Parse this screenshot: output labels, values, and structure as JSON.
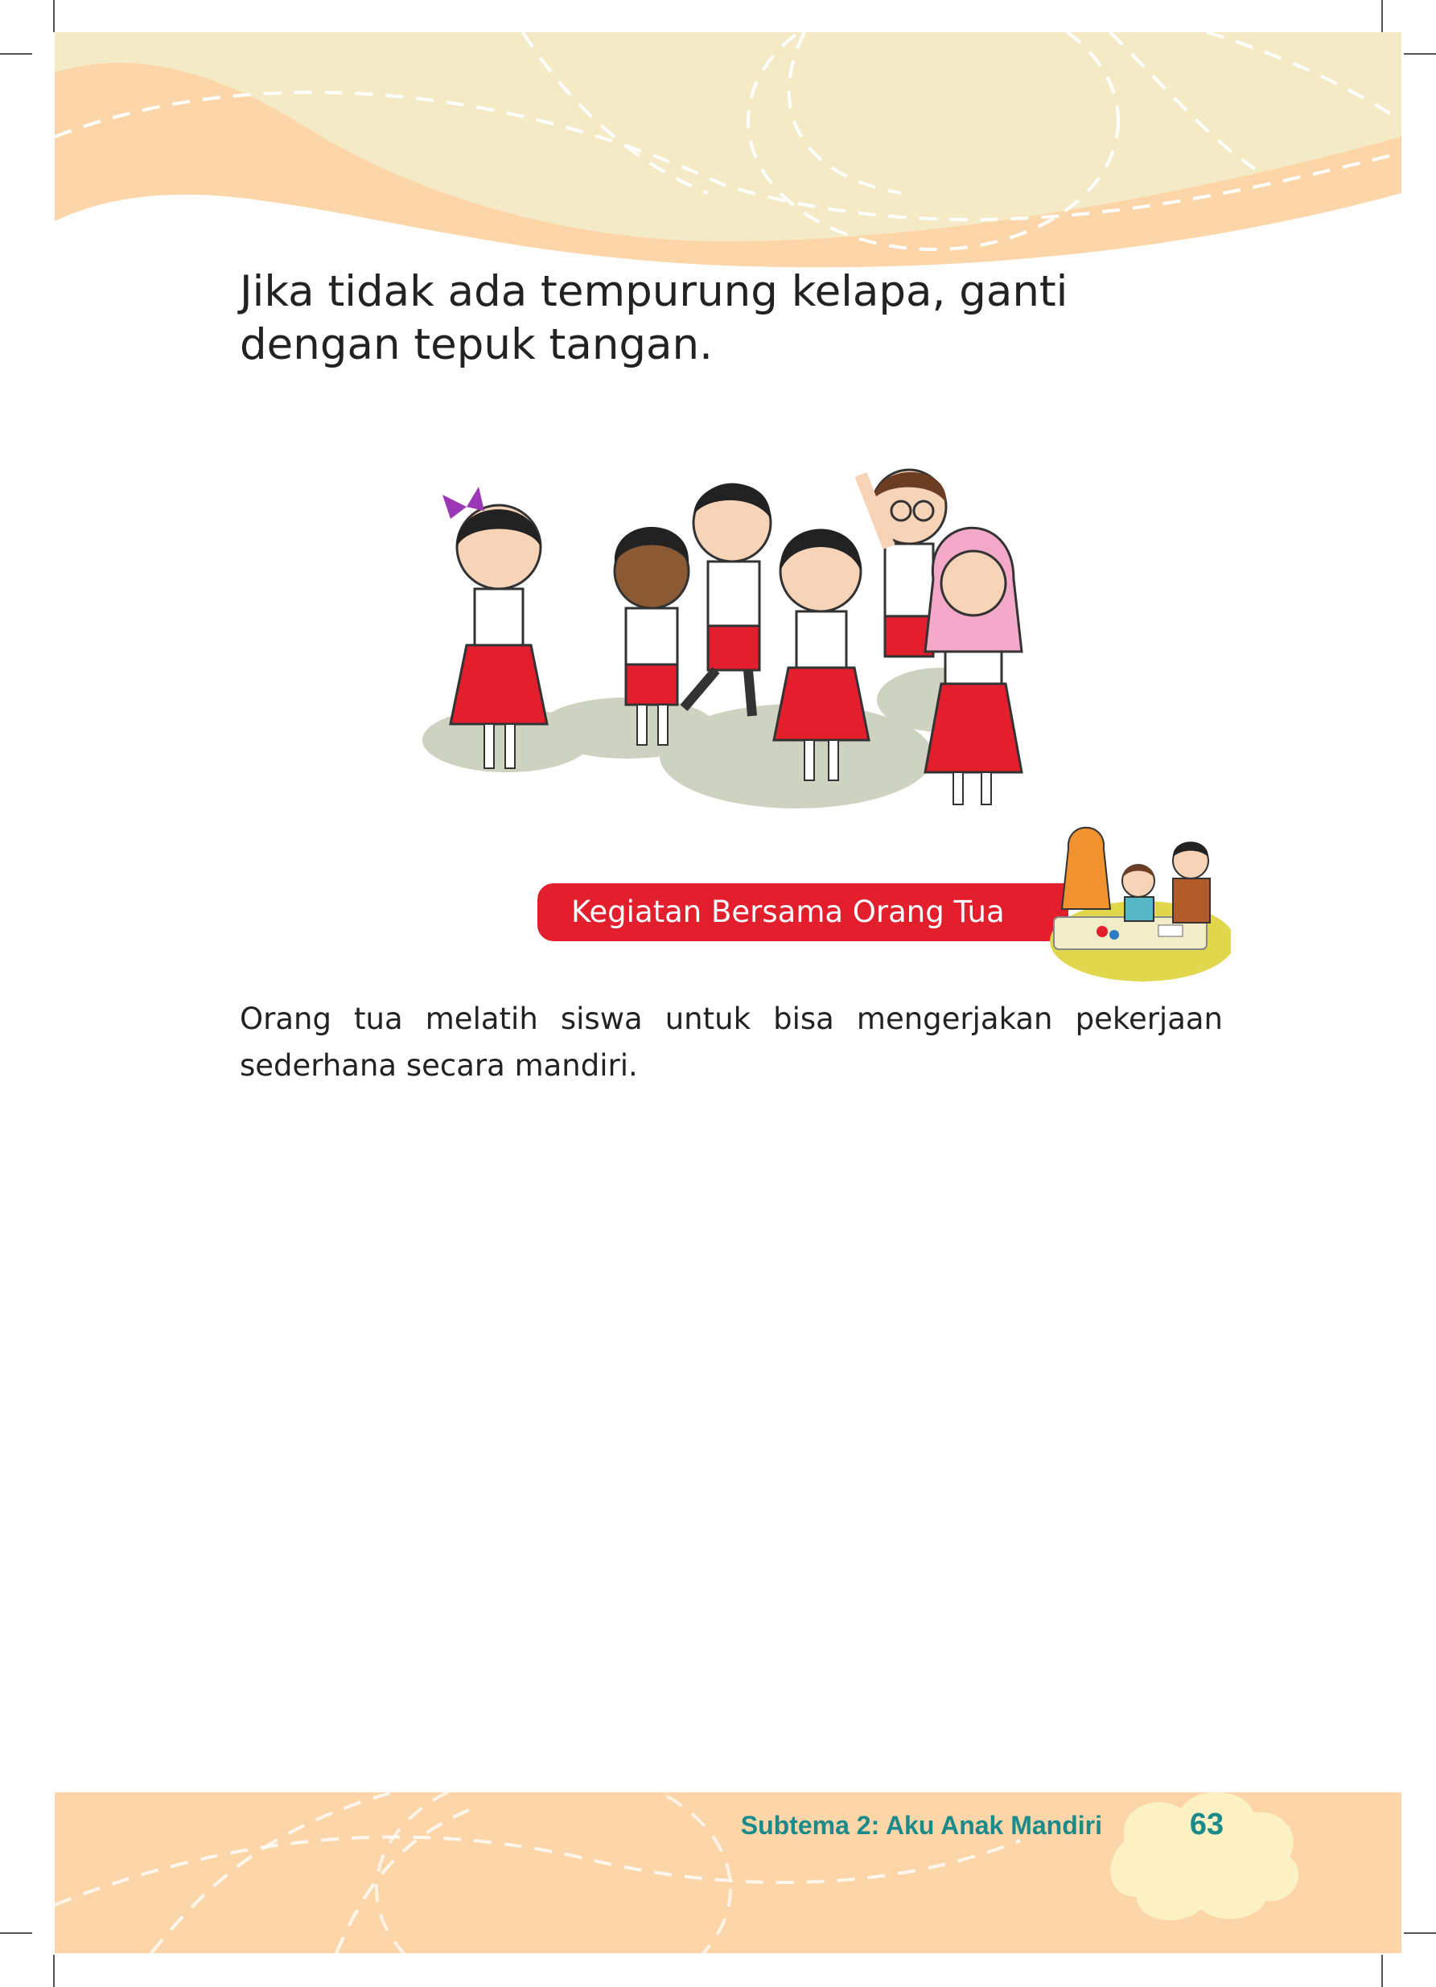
{
  "content": {
    "instruction_text": "Jika tidak ada tempurung kelapa, ganti dengan tepuk tangan."
  },
  "section": {
    "title": "Kegiatan Bersama Orang Tua",
    "body": "Orang tua melatih siswa untuk bisa mengerjakan pekerjaan sederhana secara mandiri."
  },
  "footer": {
    "subtheme": "Subtema 2: Aku Anak Mandiri",
    "page_number": "63"
  },
  "colors": {
    "header_cream": "#f4ebc6",
    "header_peach": "#fcd6a8",
    "banner_red": "#e31e2d",
    "footer_teal": "#1a8a8a",
    "uniform_red": "#e31e2d"
  },
  "icons": [
    "cloud-icon"
  ]
}
